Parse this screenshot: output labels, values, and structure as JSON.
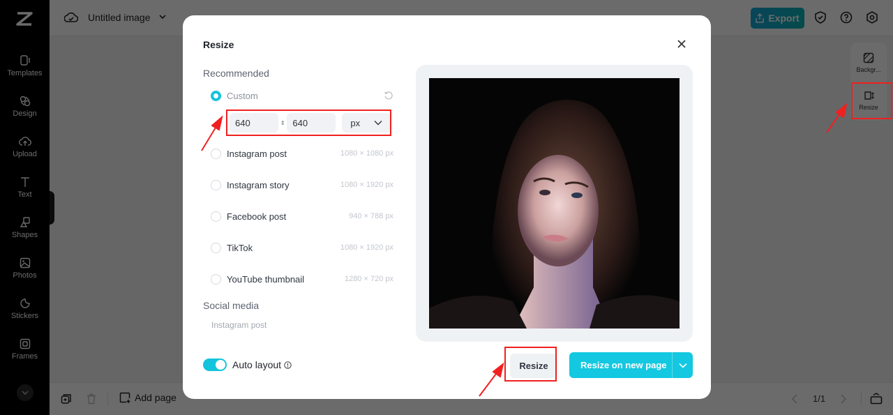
{
  "app": {
    "title": "Untitled image",
    "export_label": "Export"
  },
  "rail": {
    "items": [
      {
        "label": "Templates",
        "icon": "templates-icon"
      },
      {
        "label": "Design",
        "icon": "design-icon"
      },
      {
        "label": "Upload",
        "icon": "upload-icon"
      },
      {
        "label": "Text",
        "icon": "text-icon"
      },
      {
        "label": "Shapes",
        "icon": "shapes-icon"
      },
      {
        "label": "Photos",
        "icon": "photos-icon"
      },
      {
        "label": "Stickers",
        "icon": "stickers-icon"
      },
      {
        "label": "Frames",
        "icon": "frames-icon"
      }
    ]
  },
  "right_panel": {
    "items": [
      {
        "label": "Backgr...",
        "icon": "background-icon"
      },
      {
        "label": "Resize",
        "icon": "resize-icon"
      }
    ]
  },
  "bottom": {
    "add_page_label": "Add page",
    "page_indicator": "1/1"
  },
  "modal": {
    "title": "Resize",
    "recommended_label": "Recommended",
    "custom": {
      "label": "Custom",
      "width": "640",
      "height": "640",
      "unit": "px",
      "selected": true
    },
    "presets": [
      {
        "label": "Instagram post",
        "size": "1080 × 1080 px"
      },
      {
        "label": "Instagram story",
        "size": "1080 × 1920 px"
      },
      {
        "label": "Facebook post",
        "size": "940 × 788 px"
      },
      {
        "label": "TikTok",
        "size": "1080 × 1920 px"
      },
      {
        "label": "YouTube thumbnail",
        "size": "1280 × 720 px"
      }
    ],
    "social_media_label": "Social media",
    "social_media_items": [
      "Instagram post"
    ],
    "auto_layout_label": "Auto layout",
    "auto_layout_on": true,
    "resize_button": "Resize",
    "resize_new_page_button": "Resize on new page"
  },
  "colors": {
    "accent": "#13c4dc",
    "highlight": "#f02020",
    "export_gradient_start": "#16a4d6",
    "export_gradient_end": "#0ab3b3"
  }
}
